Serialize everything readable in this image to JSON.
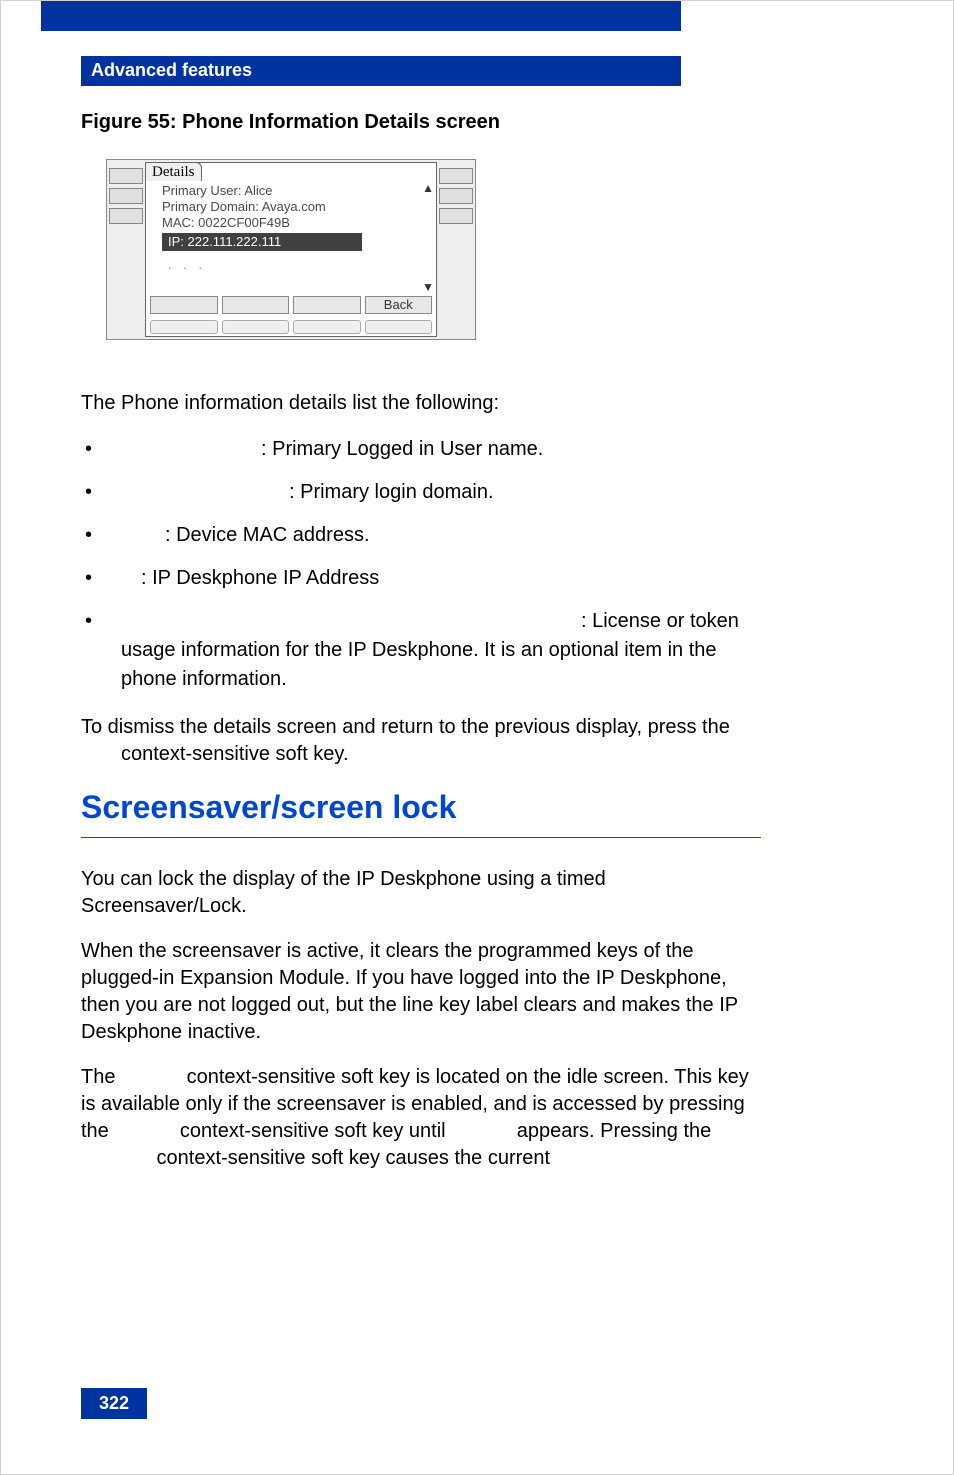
{
  "header": {
    "section_title": "Advanced features"
  },
  "figure": {
    "caption": "Figure 55: Phone Information Details screen",
    "tab_label": "Details",
    "line1": "Primary User: Alice",
    "line2": "Primary Domain: Avaya.com",
    "line3": "MAC: 0022CF00F49B",
    "ip_line": "IP:   222.111.222.111",
    "dots": ". . .",
    "softkey_back": "Back"
  },
  "intro_text": "The Phone information details list the following:",
  "details": {
    "item1_desc": ": Primary Logged in User name.",
    "item2_desc": ": Primary login domain.",
    "item3_desc": ": Device MAC address.",
    "item4_desc": ": IP Deskphone IP Address",
    "item5_lead": ": License or token",
    "item5_cont": "usage information for the IP Deskphone. It is an optional item in the phone information."
  },
  "dismiss_text_1": "To dismiss the details screen and return to the previous display, press the",
  "dismiss_text_2": "context-sensitive soft key.",
  "section_heading": "Screensaver/screen lock",
  "para1": "You can lock the display of the IP Deskphone using a timed Screensaver/Lock.",
  "para2": "When the screensaver is active, it clears the programmed keys of the plugged-in Expansion Module. If you have logged into the IP Deskphone, then you are not logged out, but the line key label clears and makes the IP Deskphone inactive.",
  "para3_a": "The ",
  "para3_b": " context-sensitive soft key is located on the idle screen. This key is available only if the screensaver is enabled, and is accessed by pressing the ",
  "para3_c": " context-sensitive soft key until ",
  "para3_d": " appears. Pressing the ",
  "para3_e": " context-sensitive soft key causes the current",
  "page_number": "322"
}
